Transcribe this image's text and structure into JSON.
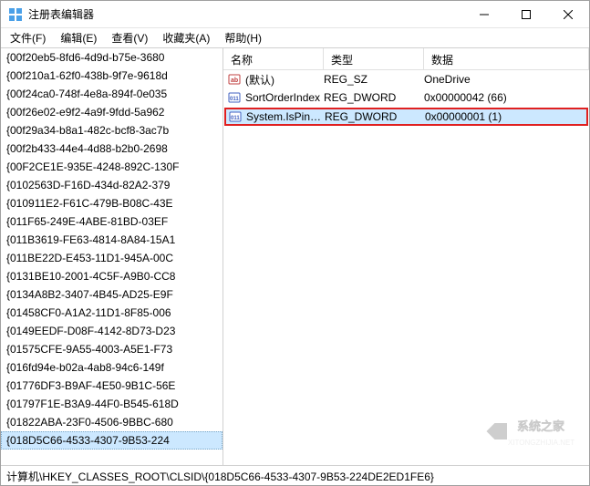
{
  "window": {
    "title": "注册表编辑器"
  },
  "menu": {
    "file": "文件(F)",
    "edit": "编辑(E)",
    "view": "查看(V)",
    "favorites": "收藏夹(A)",
    "help": "帮助(H)"
  },
  "tree": {
    "items": [
      "{00f20eb5-8fd6-4d9d-b75e-3680",
      "{00f210a1-62f0-438b-9f7e-9618d",
      "{00f24ca0-748f-4e8a-894f-0e035",
      "{00f26e02-e9f2-4a9f-9fdd-5a962",
      "{00f29a34-b8a1-482c-bcf8-3ac7b",
      "{00f2b433-44e4-4d88-b2b0-2698",
      "{00F2CE1E-935E-4248-892C-130F",
      "{0102563D-F16D-434d-82A2-379",
      "{010911E2-F61C-479B-B08C-43E",
      "{011F65-249E-4ABE-81BD-03EF",
      "{011B3619-FE63-4814-8A84-15A1",
      "{011BE22D-E453-11D1-945A-00C",
      "{0131BE10-2001-4C5F-A9B0-CC8",
      "{0134A8B2-3407-4B45-AD25-E9F",
      "{01458CF0-A1A2-11D1-8F85-006",
      "{0149EEDF-D08F-4142-8D73-D23",
      "{01575CFE-9A55-4003-A5E1-F73",
      "{016fd94e-b02a-4ab8-94c6-149f",
      "{01776DF3-B9AF-4E50-9B1C-56E",
      "{01797F1E-B3A9-44F0-B545-618D",
      "{01822ABA-23F0-4506-9BBC-680",
      "{018D5C66-4533-4307-9B53-224"
    ],
    "selected_index": 21
  },
  "list": {
    "headers": {
      "name": "名称",
      "type": "类型",
      "data": "数据"
    },
    "rows": [
      {
        "icon": "string",
        "name": "(默认)",
        "type": "REG_SZ",
        "data": "OneDrive",
        "highlighted": false,
        "selected": false
      },
      {
        "icon": "binary",
        "name": "SortOrderIndex",
        "type": "REG_DWORD",
        "data": "0x00000042 (66)",
        "highlighted": false,
        "selected": false
      },
      {
        "icon": "binary",
        "name": "System.IsPinne...",
        "type": "REG_DWORD",
        "data": "0x00000001 (1)",
        "highlighted": true,
        "selected": true
      }
    ]
  },
  "statusbar": {
    "path": "计算机\\HKEY_CLASSES_ROOT\\CLSID\\{018D5C66-4533-4307-9B53-224DE2ED1FE6}"
  },
  "watermark": {
    "text": "系统之家",
    "url": "XITONGZHIJIA.NET"
  }
}
